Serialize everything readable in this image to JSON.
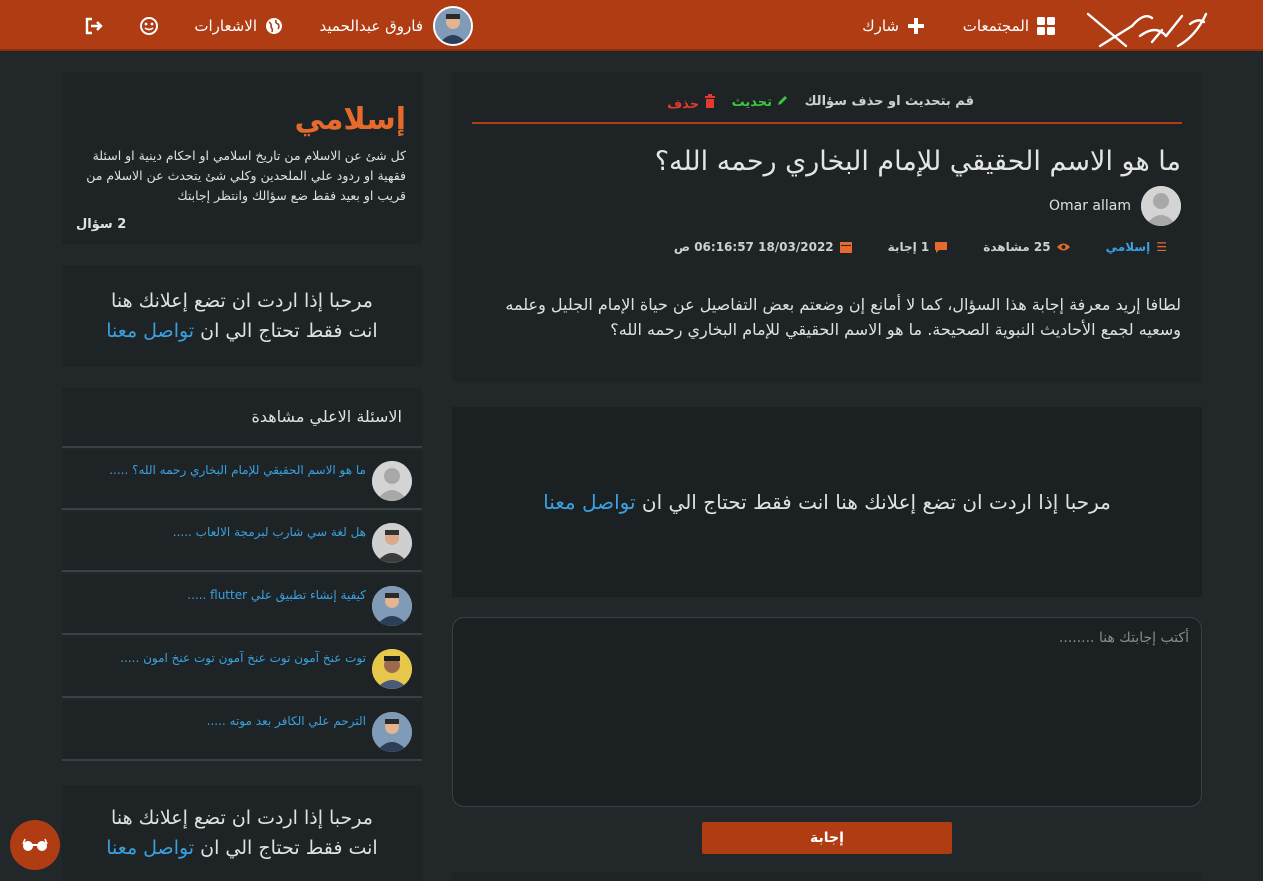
{
  "header": {
    "communities_label": "المجتمعات",
    "share_label": "شارك",
    "user_name": "فاروق عبدالحميد",
    "notifications_label": "الاشعارات"
  },
  "question": {
    "actions_label": "قم بتحديث او حذف سؤالك",
    "update_label": "تحديث",
    "delete_label": "حذف",
    "title": "ما هو الاسم الحقيقي للإمام البخاري رحمه الله؟",
    "author": "Omar allam",
    "category": "إسلامي",
    "views": "25 مشاهدة",
    "answers": "1 إجابة",
    "date": "18/03/2022 06:16:57 ص",
    "body": "لطافا إريد معرفة إجابة هذا السؤال، كما لا أمانع إن وضعتم بعض التفاصيل عن حياة الإمام الجليل وعلمه وسعيه لجمع الأحاديث النبوية الصحيحة. ما هو الاسم الحقيقي للإمام البخاري رحمه الله؟"
  },
  "ads": {
    "text": "مرحبا إذا اردت ان تضع إعلانك هنا انت فقط تحتاج الي ان",
    "link": "تواصل معنا"
  },
  "answer": {
    "placeholder": "أكتب إجابتك هنا ........",
    "submit_label": "إجابة"
  },
  "sidebar": {
    "category_title": "إسلامي",
    "category_desc": "كل شئ عن الاسلام من تاريخ اسلامي او احكام دينية او اسئلة فقهية او ردود علي الملحدين وكلي شئ يتحدث عن الاسلام من قريب او بعيد فقط ضع سؤالك وانتظر إجابتك",
    "category_count": "2 سؤال",
    "top_title": "الاسئلة الاعلي مشاهدة",
    "top_questions": [
      "ما هو الاسم الحقيقي للإمام البخاري رحمه الله؟ .....",
      "هل لغة سي شارب لبرمجة الالعاب .....",
      "كيفية إنشاء تطبيق علي flutter .....",
      "توت عنخ آمون توت عنخ آمون توت عنخ امون .....",
      "الترحم علي الكافر بعد موته ....."
    ]
  },
  "colors": {
    "accent": "#b03c14",
    "link": "#3aa0e0",
    "orange": "#e66a2c"
  }
}
